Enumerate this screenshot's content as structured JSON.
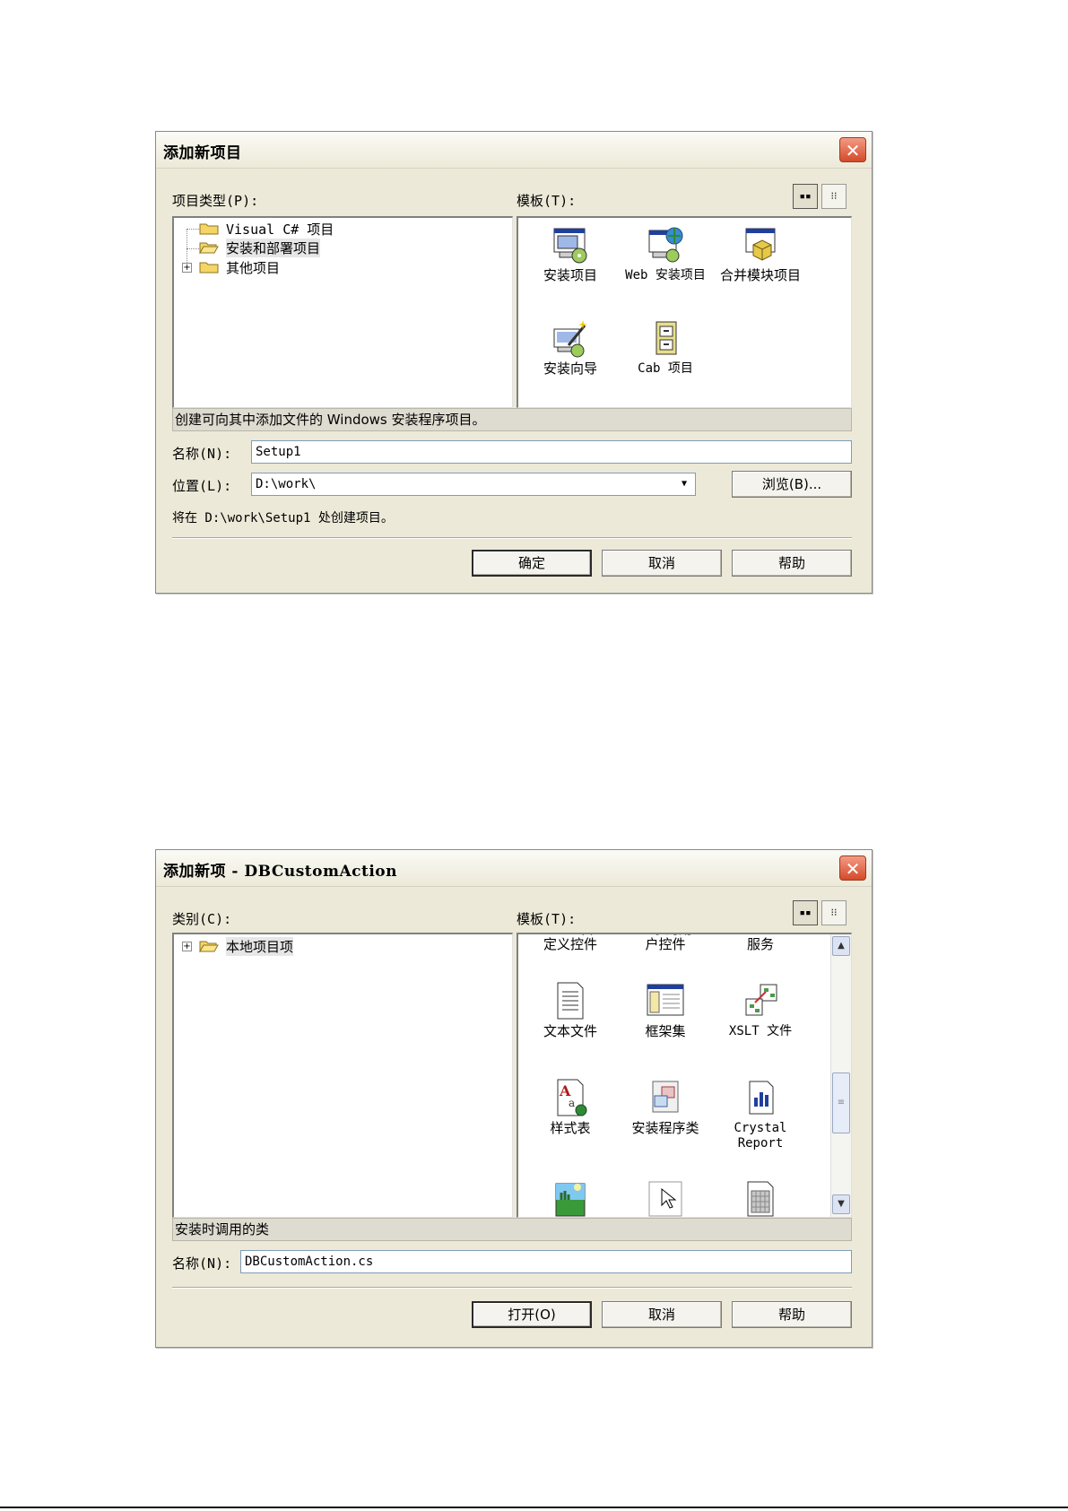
{
  "dialog1": {
    "title": "添加新项目",
    "project_types_label": "项目类型",
    "project_types_hotkey": "(P):",
    "templates_label": "模板",
    "templates_hotkey": "(T):",
    "tree": [
      {
        "label": "Visual C# 项目"
      },
      {
        "label": "安装和部署项目"
      },
      {
        "label": "其他项目"
      }
    ],
    "templates": [
      {
        "label": "安装项目",
        "icon": "setup-project-icon"
      },
      {
        "label": "Web 安装项目",
        "icon": "web-setup-project-icon"
      },
      {
        "label": "合并模块项目",
        "icon": "merge-module-icon"
      },
      {
        "label": "安装向导",
        "icon": "setup-wizard-icon"
      },
      {
        "label": "Cab 项目",
        "icon": "cab-project-icon"
      }
    ],
    "description": "创建可向其中添加文件的 Windows 安装程序项目。",
    "name_label": "名称",
    "name_hotkey": "(N):",
    "name_value": "Setup1",
    "location_label": "位置",
    "location_hotkey": "(L):",
    "location_value": "D:\\work\\",
    "browse_button": "浏览(B)...",
    "create_path_text": "将在 D:\\work\\Setup1 处创建项目。",
    "ok_button": "确定",
    "cancel_button": "取消",
    "help_button": "帮助"
  },
  "dialog2": {
    "title": "添加新项 - DBCustomAction",
    "categories_label": "类别",
    "categories_hotkey": "(C):",
    "templates_label": "模板",
    "templates_hotkey": "(T):",
    "tree": [
      {
        "label": "本地项目项"
      }
    ],
    "templates_partial_row": [
      {
        "label": "Web 自定义控件"
      },
      {
        "label": "继承的用户控件"
      },
      {
        "label": "Windows 服务"
      }
    ],
    "templates": [
      {
        "label": "文本文件",
        "icon": "text-file-icon"
      },
      {
        "label": "框架集",
        "icon": "frameset-icon"
      },
      {
        "label": "XSLT 文件",
        "icon": "xslt-file-icon"
      },
      {
        "label": "样式表",
        "icon": "style-sheet-icon"
      },
      {
        "label": "安装程序类",
        "icon": "installer-class-icon"
      },
      {
        "label": "Crystal Report",
        "icon": "crystal-report-icon"
      }
    ],
    "description": "安装时调用的类",
    "name_label": "名称",
    "name_hotkey": "(N):",
    "name_value": "DBCustomAction.cs",
    "open_button": "打开(O)",
    "cancel_button": "取消",
    "help_button": "帮助"
  }
}
